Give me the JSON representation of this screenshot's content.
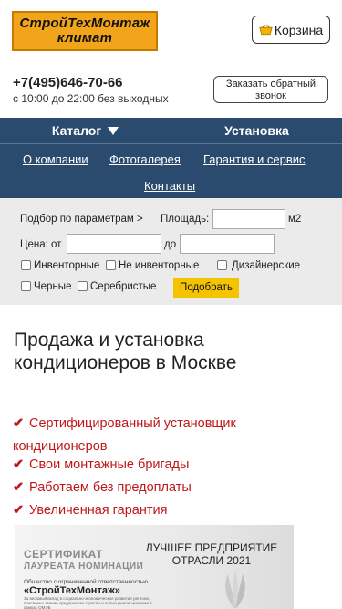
{
  "header": {
    "logo_line1": "СтройТехМонтаж",
    "logo_line2": "климат",
    "cart_label": "Корзина",
    "phone": "+7(495)646-70-66",
    "hours": "с 10:00 до 22:00 без выходных",
    "callback_label": "Заказать обратный звонок"
  },
  "nav": {
    "catalog": "Каталог",
    "install": "Установка",
    "links": [
      "О компании",
      "Фотогалерея",
      "Гарантия и сервис",
      "Контакты"
    ]
  },
  "filter": {
    "params_label": "Подбор по параметрам >",
    "area_label": "Площадь:",
    "area_unit": "м2",
    "price_label": "Цена: от",
    "price_to": "до",
    "options": [
      "Инвенторные",
      "Не инвенторные",
      "Дизайнерские",
      "Черные",
      "Серебристые"
    ],
    "submit": "Подобрать"
  },
  "main": {
    "heading": "Продажа и установка кондиционеров в Москве",
    "features": [
      "Сертифицированный установщик кондиционеров",
      "Свои монтажные бригады",
      "Работаем без предоплаты",
      "Увеличенная гарантия"
    ]
  },
  "certificate": {
    "title": "СЕРТИФИКАТ",
    "subtitle": "ЛАУРЕАТА НОМИНАЦИИ",
    "org": "Общество с ограниченной ответственностью",
    "name": "«СтройТехМонтаж»",
    "small": "За весомый вклад в социально-экономическое развитие региона, присвоено звание предприятия отрасли и полноценное значение в рамках ОМЭБ",
    "award": "ЛУЧШЕЕ ПРЕДПРИЯТИЕ ОТРАСЛИ 2021"
  },
  "colors": {
    "nav_bg": "#2a4a6e",
    "logo_bg": "#f2a51a",
    "check_red": "#c0171b",
    "submit_yellow": "#f5c400"
  }
}
